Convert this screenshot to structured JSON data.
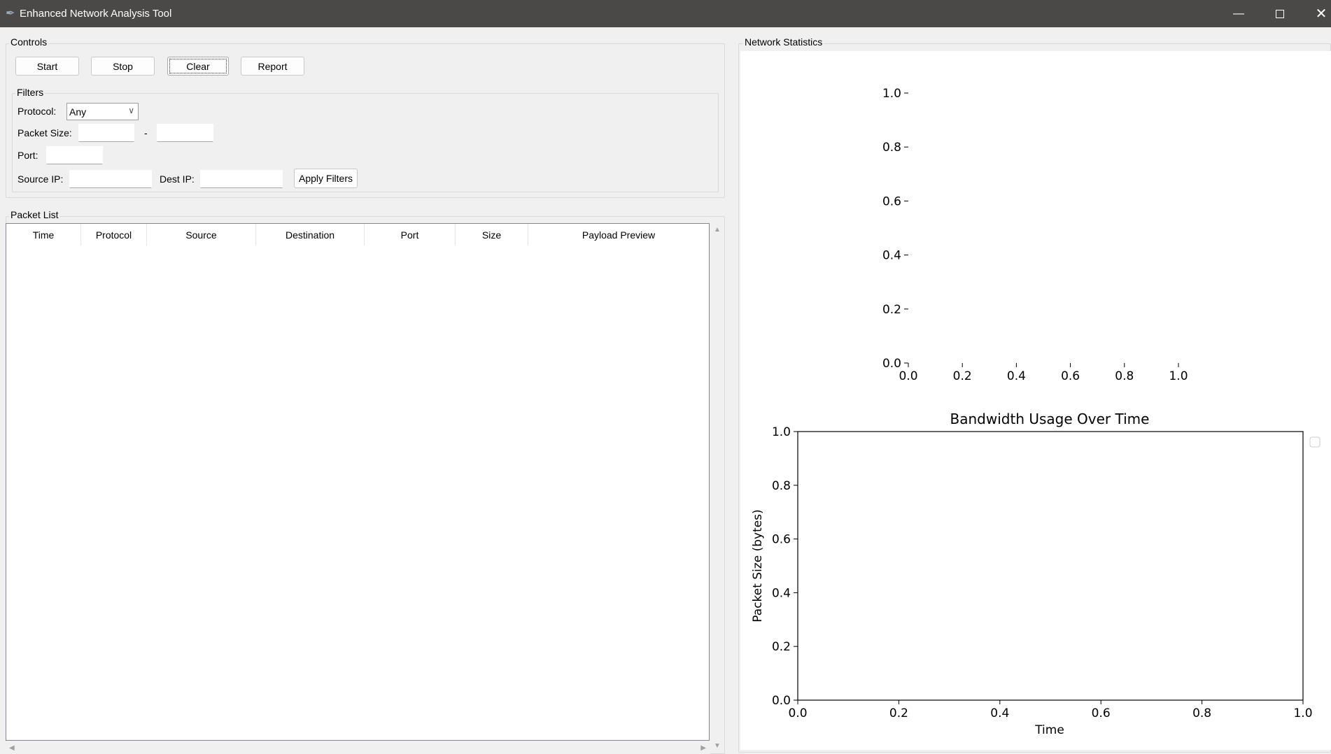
{
  "window": {
    "title": "Enhanced Network Analysis Tool",
    "icon": "feather-icon"
  },
  "controls": {
    "label": "Controls",
    "buttons": [
      "Start",
      "Stop",
      "Clear",
      "Report"
    ]
  },
  "filters": {
    "label": "Filters",
    "protocol_label": "Protocol:",
    "protocol_value": "Any",
    "packet_size_label": "Packet Size:",
    "packet_size_min": "",
    "packet_size_sep": "-",
    "packet_size_max": "",
    "port_label": "Port:",
    "port_value": "",
    "source_ip_label": "Source IP:",
    "source_ip_value": "",
    "dest_ip_label": "Dest IP:",
    "dest_ip_value": "",
    "apply_label": "Apply Filters"
  },
  "packet_list": {
    "label": "Packet List",
    "columns": [
      "Time",
      "Protocol",
      "Source",
      "Destination",
      "Port",
      "Size",
      "Payload Preview"
    ],
    "rows": []
  },
  "stats": {
    "label": "Network Statistics"
  },
  "chart_data": [
    {
      "type": "pie",
      "title": "",
      "xlim": [
        0,
        1
      ],
      "ylim": [
        0,
        1
      ],
      "xticks": [
        "0.0",
        "0.2",
        "0.4",
        "0.6",
        "0.8",
        "1.0"
      ],
      "yticks": [
        "0.0",
        "0.2",
        "0.4",
        "0.6",
        "0.8",
        "1.0"
      ],
      "values": [],
      "grid": false
    },
    {
      "type": "line",
      "title": "Bandwidth Usage Over Time",
      "xlabel": "Time",
      "ylabel": "Packet Size (bytes)",
      "xlim": [
        0,
        1
      ],
      "ylim": [
        0,
        1
      ],
      "xticks": [
        "0.0",
        "0.2",
        "0.4",
        "0.6",
        "0.8",
        "1.0"
      ],
      "yticks": [
        "0.0",
        "0.2",
        "0.4",
        "0.6",
        "0.8",
        "1.0"
      ],
      "series": [],
      "legend": "upper-right-outside (empty)",
      "grid": false
    }
  ]
}
